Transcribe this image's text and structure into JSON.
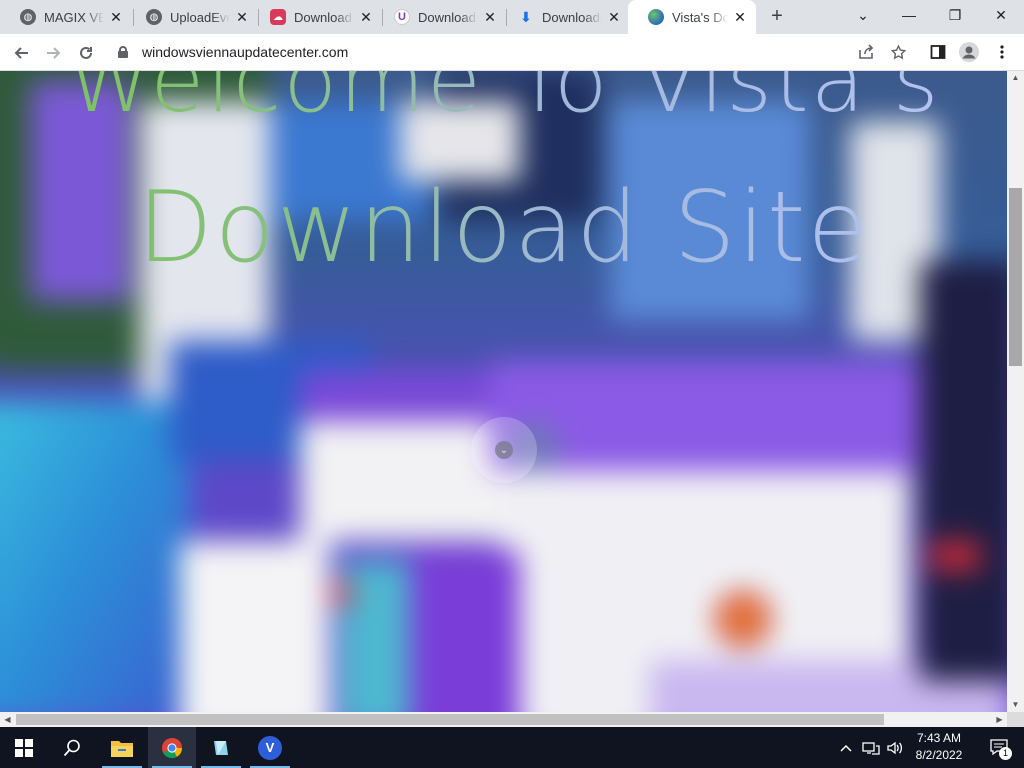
{
  "browser": {
    "tabs": [
      {
        "title": "MAGIX VEG",
        "icon": "globe-icon",
        "active": false
      },
      {
        "title": "UploadEver",
        "icon": "globe-icon",
        "active": false
      },
      {
        "title": "Download",
        "icon": "cloud-red-icon",
        "active": false
      },
      {
        "title": "Download",
        "icon": "u-logo-icon",
        "active": false
      },
      {
        "title": "Downloads",
        "icon": "download-arrow-icon",
        "active": false
      },
      {
        "title": "Vista's Dov",
        "icon": "earth-globe-icon",
        "active": true
      }
    ],
    "close_glyph": "✕",
    "new_tab_glyph": "+",
    "url": "windowsviennaupdatecenter.com",
    "window_controls": {
      "dropdown": "⌄",
      "minimize": "—",
      "restore": "❐",
      "close": "✕"
    }
  },
  "page": {
    "heading_line1": "Welcome To Vista's",
    "heading_line2": "Download Site",
    "scroll_glyph": "⌄"
  },
  "taskbar": {
    "time": "7:43 AM",
    "date": "8/2/2022",
    "notification_count": "1",
    "pinned": [
      "start-icon",
      "search-icon",
      "file-explorer-icon",
      "chrome-icon",
      "app-icon",
      "v-app-icon"
    ],
    "v_app_letter": "V"
  },
  "colors": {
    "tabstrip": "#dee1e6",
    "taskbar": "#101420",
    "accent": "#76b9ed",
    "heading_green": "#7ac35a",
    "heading_lavender": "#b6c4f6"
  }
}
